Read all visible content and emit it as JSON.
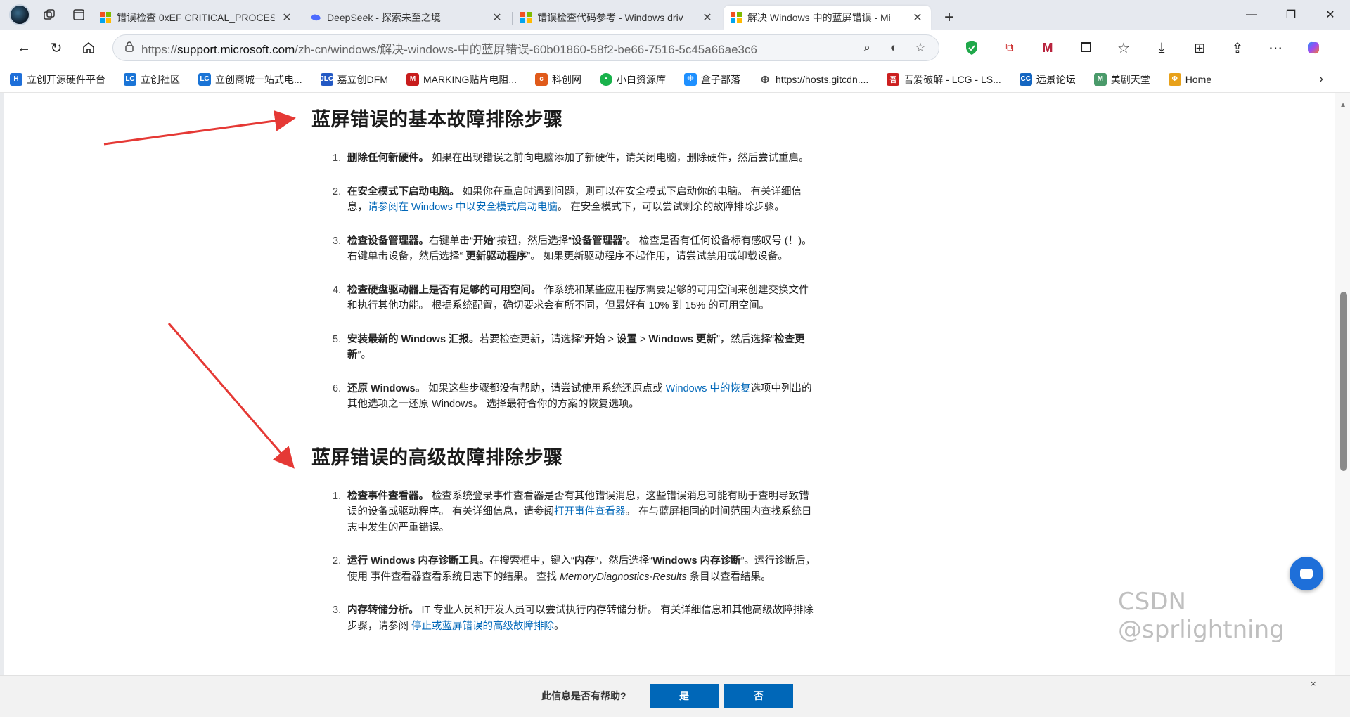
{
  "tabs": [
    {
      "label": "错误检查 0xEF CRITICAL_PROCESS",
      "icon": "microsoft-logo",
      "active": false
    },
    {
      "label": "DeepSeek - 探索未至之境",
      "icon": "deepseek-icon",
      "active": false
    },
    {
      "label": "错误检查代码参考 - Windows driv",
      "icon": "microsoft-logo",
      "active": false
    },
    {
      "label": "解决 Windows 中的蓝屏错误 - Mi",
      "icon": "microsoft-logo",
      "active": true
    }
  ],
  "address": {
    "scheme": "https://",
    "host": "support.microsoft.com",
    "path": "/zh-cn/windows/解决-windows-中的蓝屏错误-60b01860-58f2-be66-7516-5c45a66ae3c6"
  },
  "bookmarks": [
    {
      "label": "立创开源硬件平台",
      "icon": "oshw-icon",
      "color": "#1e6fd9",
      "glyph": "H"
    },
    {
      "label": "立创社区",
      "icon": "lc-icon",
      "color": "#1a74d6",
      "glyph": "LC"
    },
    {
      "label": "立创商城一站式电...",
      "icon": "lc-icon",
      "color": "#1a74d6",
      "glyph": "LC"
    },
    {
      "label": "嘉立创DFM",
      "icon": "jlc-icon",
      "color": "#2359c4",
      "glyph": "JLC"
    },
    {
      "label": "MARKING贴片电阻...",
      "icon": "marking-icon",
      "color": "#c81c1c",
      "glyph": "M"
    },
    {
      "label": "科创网",
      "icon": "kechuang-icon",
      "color": "#e05a1a",
      "glyph": "c"
    },
    {
      "label": "小白资源库",
      "icon": "wechat-icon",
      "color": "#19b24b",
      "glyph": "•"
    },
    {
      "label": "盒子部落",
      "icon": "box-icon",
      "color": "#1e90ff",
      "glyph": "※"
    },
    {
      "label": "https://hosts.gitcdn....",
      "icon": "globe-icon",
      "color": "#555555",
      "glyph": "⊕"
    },
    {
      "label": "吾爱破解 - LCG - LS...",
      "icon": "52pojie-icon",
      "color": "#cc1f1f",
      "glyph": "吾"
    },
    {
      "label": "远景论坛",
      "icon": "pcbeta-icon",
      "color": "#1466c1",
      "glyph": "CC"
    },
    {
      "label": "美剧天堂",
      "icon": "meiju-icon",
      "color": "#4a9a6a",
      "glyph": "M"
    },
    {
      "label": "Home",
      "icon": "home-page-icon",
      "color": "#e8a11a",
      "glyph": "Φ"
    }
  ],
  "section1": {
    "title": "蓝屏错误的基本故障排除步骤",
    "steps": [
      {
        "num": "1.",
        "bold": "删除任何新硬件。",
        "text": " 如果在出现错误之前向电脑添加了新硬件，请关闭电脑，删除硬件，然后尝试重启。"
      },
      {
        "num": "2.",
        "bold": "在安全模式下启动电脑。",
        "text": " 如果你在重启时遇到问题，则可以在安全模式下启动你的电脑。 有关详细信息，",
        "link": "请参阅在 Windows 中以安全模式启动电脑",
        "tail": "。 在安全模式下，可以尝试剩余的故障排除步骤。"
      },
      {
        "num": "3.",
        "bold": "检查设备管理器。",
        "text": "右键单击“",
        "bold2": "开始",
        "text2": "”按钮，然后选择“",
        "bold3": "设备管理器",
        "text3": "”。 检查是否有任何设备标有感叹号 (！)。 右键单击设备，然后选择“",
        "bold4": " 更新驱动程序",
        "tail": "”。 如果更新驱动程序不起作用，请尝试禁用或卸载设备。"
      },
      {
        "num": "4.",
        "bold": "检查硬盘驱动器上是否有足够的可用空间。",
        "text": " 作系统和某些应用程序需要足够的可用空间来创建交换文件和执行其他功能。 根据系统配置，确切要求会有所不同，但最好有 10% 到 15% 的可用空间。"
      },
      {
        "num": "5.",
        "bold": "安装最新的 Windows 汇报。",
        "text": "若要检查更新，请选择“",
        "bold2": "开始",
        "text2": " > ",
        "bold3": "设置",
        "text3": " > ",
        "bold4": "Windows 更新",
        "tail": "”，然后选择“",
        "bold5": "检查更新",
        "tail2": "”。"
      },
      {
        "num": "6.",
        "bold": "还原 Windows。",
        "text": " 如果这些步骤都没有帮助，请尝试使用系统还原点或 ",
        "link": "Windows 中的恢复",
        "tail": "选项中列出的其他选项之一还原 Windows。 选择最符合你的方案的恢复选项。"
      }
    ]
  },
  "section2": {
    "title": "蓝屏错误的高级故障排除步骤",
    "steps": [
      {
        "num": "1.",
        "bold": "检查事件查看器。",
        "text": " 检查系统登录事件查看器是否有其他错误消息，这些错误消息可能有助于查明导致错误的设备或驱动程序。 有关详细信息，请参阅",
        "link": "打开事件查看器",
        "tail": "。 在与蓝屏相同的时间范围内查找系统日志中发生的严重错误。"
      },
      {
        "num": "2.",
        "bold": "运行 Windows 内存诊断工具。",
        "text": "在搜索框中，键入“",
        "bold2": "内存",
        "text2": "”，然后选择“",
        "bold3": "Windows 内存诊断",
        "text3": "”。运行诊断后，使用 事件查看器查看系统日志下的结果。 查找 ",
        "italic": "MemoryDiagnostics-Results",
        "tail": " 条目以查看结果。"
      },
      {
        "num": "3.",
        "bold": "内存转储分析。",
        "text": " IT 专业人员和开发人员可以尝试执行内存转储分析。 有关详细信息和其他高级故障排除步骤，请参阅 ",
        "link": "停止或蓝屏错误的高级故障排除",
        "tail": "。"
      }
    ]
  },
  "feedback": {
    "question": "此信息是否有帮助?",
    "yes": "是",
    "no": "否",
    "close": "×"
  },
  "watermark": "CSDN @sprlightning",
  "colors": {
    "link": "#0067b8",
    "button": "#0067b8",
    "annotation_arrow": "#e53935"
  }
}
